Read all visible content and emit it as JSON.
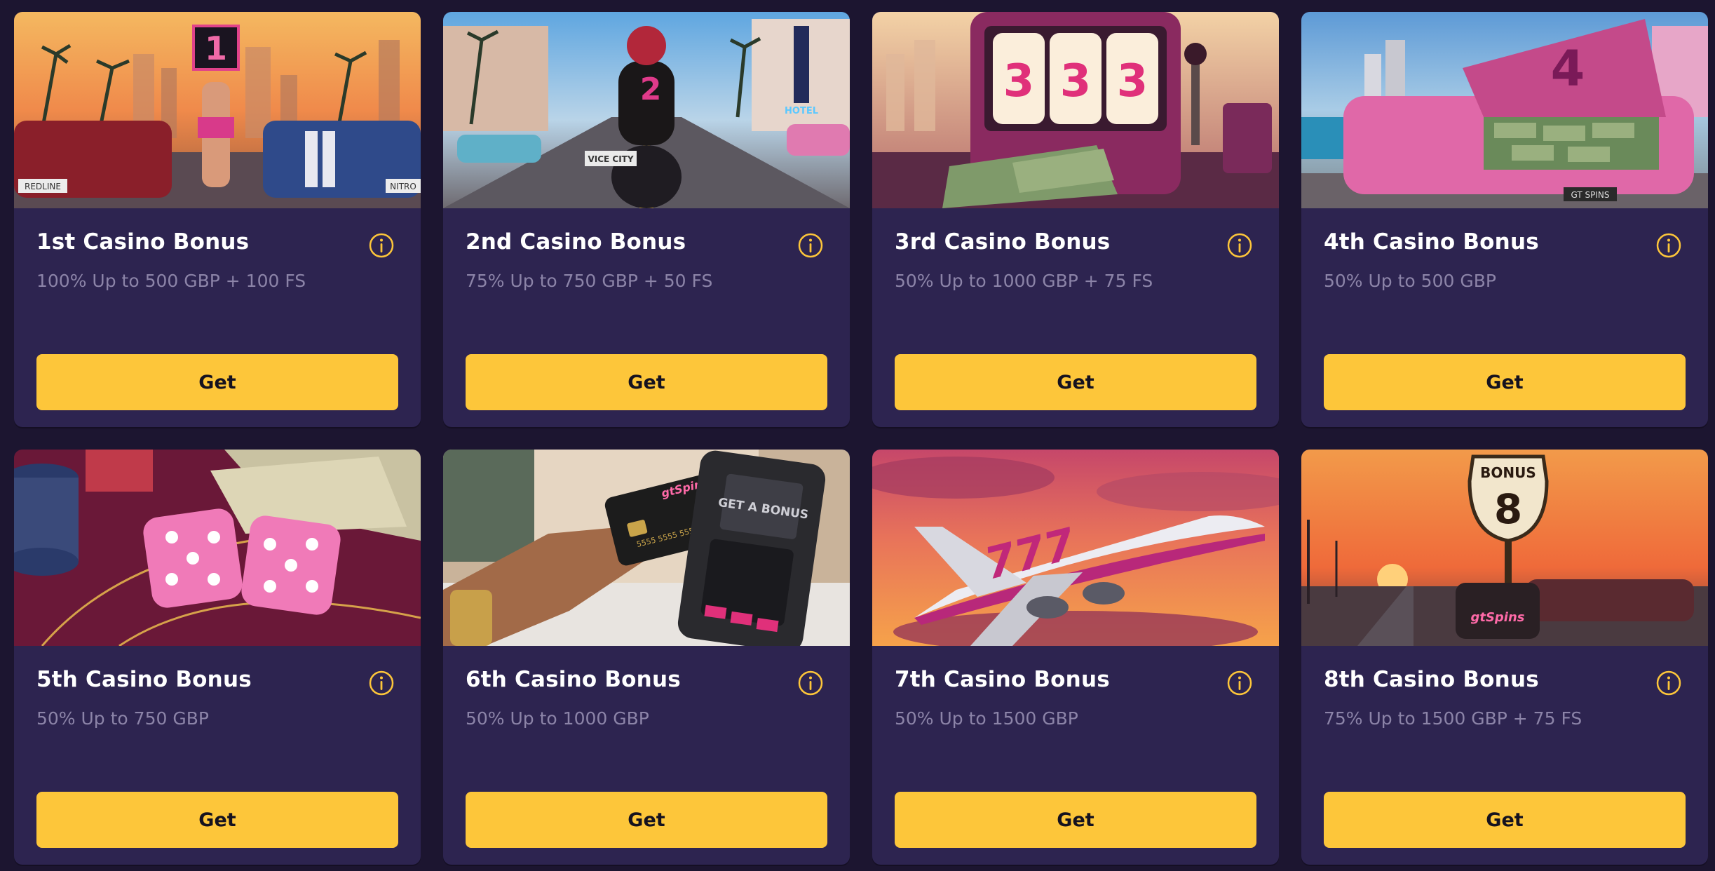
{
  "theme": {
    "background": "#1c1530",
    "card": "#2d2450",
    "accent": "#fdc63a",
    "title_text": "#ffffff",
    "subtitle_text": "#8c84a8"
  },
  "cards": [
    {
      "title": "1st Casino Bonus",
      "subtitle": "100% Up to 500 GBP + 100 FS",
      "button": "Get",
      "image": "sunset-street-two-muscle-cars-sign-1",
      "image_text": {
        "sign": "1",
        "plate_left": "REDLINE",
        "plate_right": "NITRO"
      },
      "info_icon": "info-circle-icon"
    },
    {
      "title": "2nd Casino Bonus",
      "subtitle": "75% Up to 750 GBP + 50 FS",
      "button": "Get",
      "image": "motorcycle-rider-neon-boulevard",
      "image_text": {
        "jacket": "2",
        "plate": "VICE CITY",
        "neon_sign": "HOTEL"
      },
      "info_icon": "info-circle-icon"
    },
    {
      "title": "3rd Casino Bonus",
      "subtitle": "50% Up to 1000 GBP + 75 FS",
      "button": "Get",
      "image": "slot-machine-triple-three-cash",
      "image_text": {
        "reels": [
          "3",
          "3",
          "3"
        ]
      },
      "info_icon": "info-circle-icon"
    },
    {
      "title": "4th Casino Bonus",
      "subtitle": "50% Up to 500 GBP",
      "button": "Get",
      "image": "pink-car-trunk-cash-beach",
      "image_text": {
        "trunk": "4",
        "plate": "GT SPINS"
      },
      "info_icon": "info-circle-icon"
    },
    {
      "title": "5th Casino Bonus",
      "subtitle": "50% Up to 750 GBP",
      "button": "Get",
      "image": "pink-dice-chips-banknotes",
      "image_text": {},
      "info_icon": "info-circle-icon"
    },
    {
      "title": "6th Casino Bonus",
      "subtitle": "50% Up to 1000 GBP",
      "button": "Get",
      "image": "hand-card-payment-terminal",
      "image_text": {
        "card_logo": "gtSpins",
        "card_number": "5555 5555 5555 5555",
        "terminal": "GET A BONUS"
      },
      "info_icon": "info-circle-icon"
    },
    {
      "title": "7th Casino Bonus",
      "subtitle": "50% Up to 1500 GBP",
      "button": "Get",
      "image": "jet-plane-777-sunset-sky",
      "image_text": {
        "tail": "777"
      },
      "info_icon": "info-circle-icon"
    },
    {
      "title": "8th Casino Bonus",
      "subtitle": "75% Up to 1500 GBP + 75 FS",
      "button": "Get",
      "image": "highway-sign-bonus-8-sunset",
      "image_text": {
        "sign_top": "BONUS",
        "sign_number": "8",
        "bag_logo": "gtSpins"
      },
      "info_icon": "info-circle-icon"
    }
  ]
}
